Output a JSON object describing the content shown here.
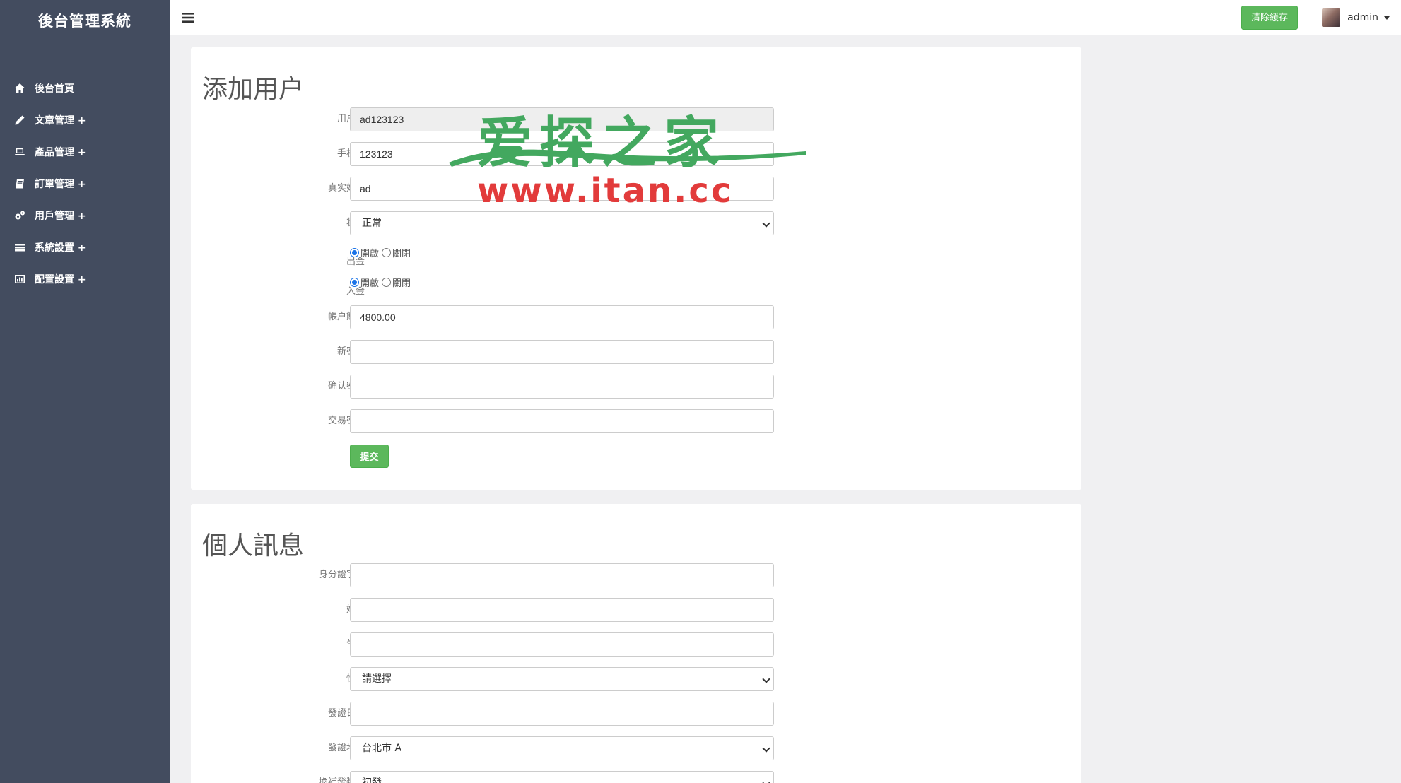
{
  "sidebar": {
    "brand": "後台管理系統",
    "items": [
      {
        "label": "後台首頁",
        "icon": "home-icon"
      },
      {
        "label": "文章管理 +",
        "icon": "pencil-icon"
      },
      {
        "label": "產品管理 +",
        "icon": "laptop-icon"
      },
      {
        "label": "訂單管理 +",
        "icon": "book-icon"
      },
      {
        "label": "用戶管理 +",
        "icon": "gears-icon"
      },
      {
        "label": "系統設置 +",
        "icon": "list-icon"
      },
      {
        "label": "配置設置 +",
        "icon": "bar-chart-icon"
      }
    ]
  },
  "topbar": {
    "clear_cache_label": "清除緩存",
    "username": "admin"
  },
  "add_user": {
    "title": "添加用户",
    "fields": {
      "username": {
        "label": "用户名",
        "value": "ad123123"
      },
      "phone": {
        "label": "手机号",
        "value": "123123"
      },
      "realname": {
        "label": "真实姓名",
        "value": "ad"
      },
      "status": {
        "label": "状态",
        "value": "正常"
      },
      "withdraw": {
        "label": "出金",
        "on": "開啟",
        "off": "關閉"
      },
      "deposit": {
        "label": "入金",
        "on": "開啟",
        "off": "關閉"
      },
      "balance": {
        "label": "帳户餘額",
        "value": "4800.00"
      },
      "new_password": {
        "label": "新密码",
        "value": ""
      },
      "confirm_password": {
        "label": "确认密码",
        "value": ""
      },
      "trade_password": {
        "label": "交易密碼",
        "value": ""
      }
    },
    "submit_label": "提交"
  },
  "personal_info": {
    "title": "個人訊息",
    "fields": {
      "id_number": {
        "label": "身分證字號",
        "value": ""
      },
      "name": {
        "label": "姓名",
        "value": ""
      },
      "birthday": {
        "label": "生日",
        "value": ""
      },
      "gender": {
        "label": "性別",
        "value": "請選擇"
      },
      "issue_date": {
        "label": "發證日期",
        "value": ""
      },
      "issue_place": {
        "label": "發證地點",
        "value": "台北市 A"
      },
      "issue_type": {
        "label": "換補發類別",
        "value": "初發"
      }
    }
  },
  "watermark": {
    "line1": "爱探之家",
    "line2": "www.itan.cc"
  },
  "colors": {
    "sidebar_bg": "#434c5f",
    "success": "#5cb85c",
    "page_bg": "#f0f0f2"
  }
}
